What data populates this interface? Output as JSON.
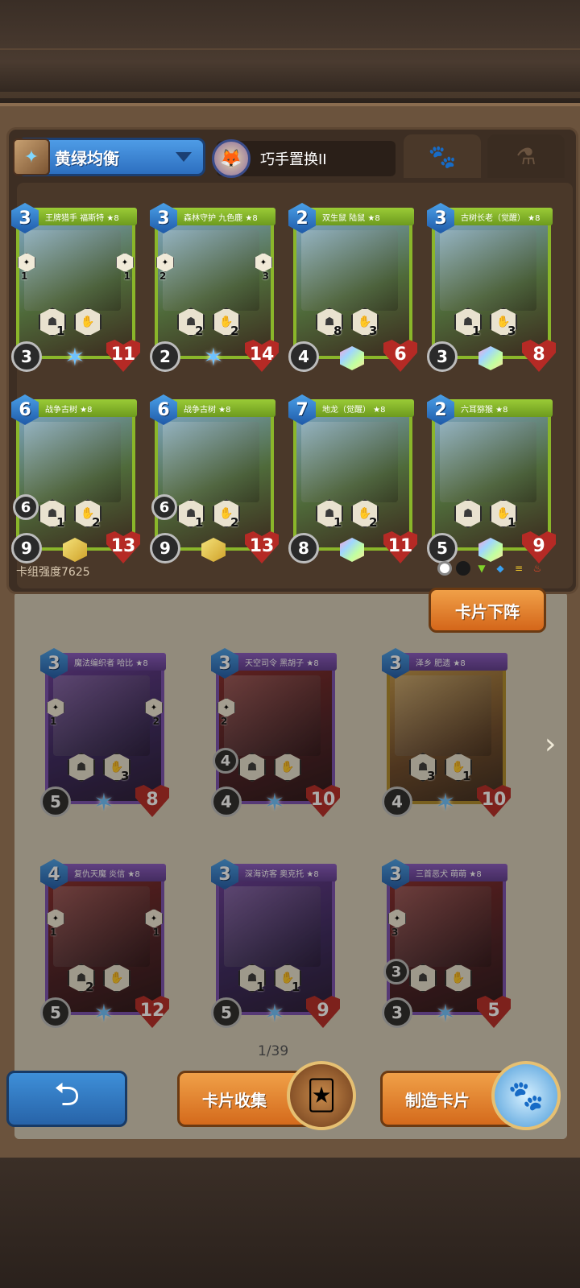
{
  "deck_selector": {
    "name": "黄绿均衡",
    "book_icon": "book-icon"
  },
  "hero": {
    "name": "巧手置换II",
    "avatar_icon": "hero-portrait"
  },
  "tabs": [
    {
      "icon": "paw-icon",
      "glyph": "🐾"
    },
    {
      "icon": "flask-icon",
      "glyph": "⚗"
    }
  ],
  "deck_cards": [
    {
      "cost": "3",
      "name": "王牌猎手 福斯特 ★8",
      "skill1": "1",
      "skill2": "",
      "side_left": "1",
      "side_right": "1",
      "extra": "",
      "atk": "3",
      "hp": "11",
      "bottom": "star"
    },
    {
      "cost": "3",
      "name": "森林守护 九色鹿 ★8",
      "skill1": "2",
      "skill2": "2",
      "side_left": "2",
      "side_right": "3",
      "extra": "",
      "atk": "2",
      "hp": "14",
      "bottom": "star"
    },
    {
      "cost": "2",
      "name": "双生鼠 陆鼠 ★8",
      "skill1": "8",
      "skill2": "3",
      "side_left": "",
      "side_right": "",
      "extra": "",
      "atk": "4",
      "hp": "6",
      "bottom": "rainbow"
    },
    {
      "cost": "3",
      "name": "古树长老（觉醒） ★8",
      "skill1": "1",
      "skill2": "3",
      "side_left": "",
      "side_right": "",
      "extra": "",
      "atk": "3",
      "hp": "8",
      "bottom": "rainbow"
    },
    {
      "cost": "6",
      "name": "战争古树 ★8",
      "skill1": "1",
      "skill2": "2",
      "side_left": "",
      "side_right": "",
      "extra": "6",
      "atk": "9",
      "hp": "13",
      "bottom": "gold"
    },
    {
      "cost": "6",
      "name": "战争古树 ★8",
      "skill1": "1",
      "skill2": "2",
      "side_left": "",
      "side_right": "",
      "extra": "6",
      "atk": "9",
      "hp": "13",
      "bottom": "gold"
    },
    {
      "cost": "7",
      "name": "地龙（觉醒） ★8",
      "skill1": "1",
      "skill2": "2",
      "side_left": "",
      "side_right": "",
      "extra": "",
      "atk": "8",
      "hp": "11",
      "bottom": "rainbow"
    },
    {
      "cost": "2",
      "name": "六耳猕猴 ★8",
      "skill1": "",
      "skill2": "1",
      "side_left": "",
      "side_right": "",
      "extra": "",
      "atk": "5",
      "hp": "9",
      "bottom": "rainbow"
    }
  ],
  "deck_power": "卡组强度7625",
  "filter_icons": [
    "all-filter-icon",
    "neutral-icon",
    "green-icon",
    "blue-icon",
    "yellow-icon",
    "red-icon"
  ],
  "remove_button": "卡片下阵",
  "collection_cards": [
    {
      "cost": "3",
      "name": "魔法编织者 哈比 ★8",
      "skill1": "",
      "skill2": "3",
      "side_left": "1",
      "side_right": "2",
      "extra": "",
      "atk": "5",
      "hp": "8"
    },
    {
      "cost": "3",
      "name": "天空司令 黑胡子 ★8",
      "skill1": "",
      "skill2": "",
      "side_left": "2",
      "side_right": "",
      "extra": "4",
      "atk": "4",
      "hp": "10"
    },
    {
      "cost": "3",
      "name": "泽乡 肥遗 ★8",
      "skill1": "3",
      "skill2": "1",
      "side_left": "",
      "side_right": "",
      "extra": "",
      "atk": "4",
      "hp": "10"
    },
    {
      "cost": "4",
      "name": "复仇天魔 炎信 ★8",
      "skill1": "2",
      "skill2": "",
      "side_left": "1",
      "side_right": "1",
      "extra": "",
      "atk": "5",
      "hp": "12"
    },
    {
      "cost": "3",
      "name": "深海访客 奥克托 ★8",
      "skill1": "1",
      "skill2": "1",
      "side_left": "",
      "side_right": "",
      "extra": "",
      "atk": "5",
      "hp": "9"
    },
    {
      "cost": "3",
      "name": "三首恶犬 萌萌 ★8",
      "skill1": "",
      "skill2": "",
      "side_left": "3",
      "side_right": "",
      "extra": "3",
      "atk": "3",
      "hp": "5"
    }
  ],
  "page_indicator": "1/39",
  "bottom": {
    "back_icon": "back-arrow-icon",
    "collect_label": "卡片收集",
    "craft_label": "制造卡片"
  }
}
